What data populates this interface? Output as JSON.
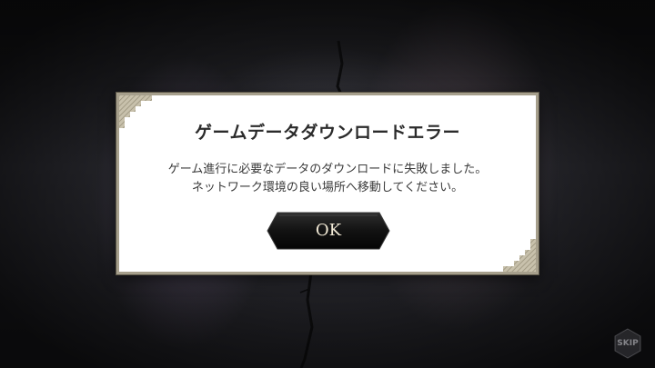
{
  "dialog": {
    "title": "ゲームデータダウンロードエラー",
    "message_line1": "ゲーム進行に必要なデータのダウンロードに失敗しました。",
    "message_line2": "ネットワーク環境の良い場所へ移動してください。",
    "ok_label": "OK"
  },
  "skip": {
    "label": "SKIP"
  },
  "colors": {
    "dialog_border": "#a69f8c",
    "button_fill": "#141414",
    "button_text": "#f2ead6"
  }
}
